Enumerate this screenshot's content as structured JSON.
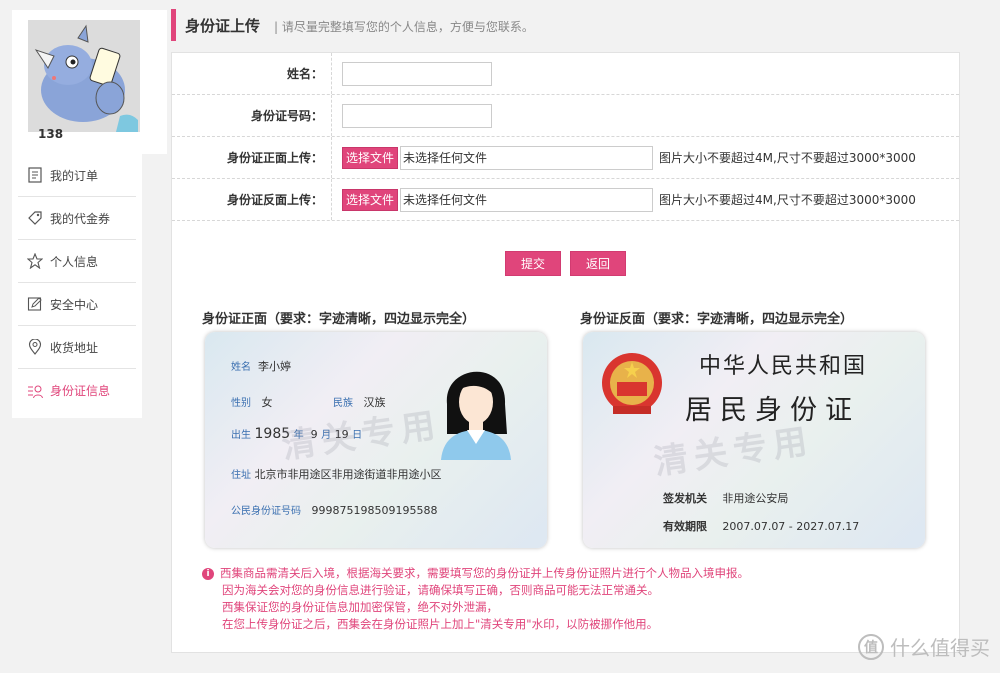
{
  "sidebar": {
    "username": "138",
    "items": [
      {
        "label": "我的订单",
        "icon": "order-list-icon"
      },
      {
        "label": "我的代金券",
        "icon": "coupon-tag-icon"
      },
      {
        "label": "个人信息",
        "icon": "star-icon"
      },
      {
        "label": "安全中心",
        "icon": "edit-shield-icon"
      },
      {
        "label": "收货地址",
        "icon": "location-pin-icon"
      },
      {
        "label": "身份证信息",
        "icon": "id-user-icon"
      }
    ],
    "active_index": 5
  },
  "header": {
    "title": "身份证上传",
    "subtitle": "| 请尽量完整填写您的个人信息，方便与您联系。"
  },
  "form": {
    "name_label": "姓名：",
    "name_value": "",
    "idno_label": "身份证号码：",
    "idno_value": "",
    "front_label": "身份证正面上传：",
    "back_label": "身份证反面上传：",
    "file_button": "选择文件",
    "file_none": "未选择任何文件",
    "size_hint": "图片大小不要超过4M,尺寸不要超过3000*3000",
    "submit": "提交",
    "back": "返回"
  },
  "samples": {
    "front_title": "身份证正面（要求：字迹清晰，四边显示完全）",
    "back_title": "身份证反面（要求：字迹清晰，四边显示完全）",
    "front": {
      "name_lbl": "姓名",
      "name": "李小婷",
      "sex_lbl": "性别",
      "sex": "女",
      "nation_lbl": "民族",
      "nation": "汉族",
      "birth_lbl": "出生",
      "year": "1985",
      "year_lbl": "年",
      "month": "9",
      "month_lbl": "月",
      "day": "19",
      "day_lbl": "日",
      "addr_lbl": "住址",
      "addr": "北京市非用途区非用途街道非用途小区",
      "id_lbl": "公民身份证号码",
      "id": "999875198509195588",
      "watermark": "清关专用"
    },
    "back": {
      "country": "中华人民共和国",
      "card": "居民身份证",
      "issuer_lbl": "签发机关",
      "issuer": "非用途公安局",
      "valid_lbl": "有效期限",
      "valid": "2007.07.07 - 2027.07.17",
      "watermark": "清关专用"
    }
  },
  "notice": {
    "icon": "i",
    "lines": [
      "西集商品需清关后入境，根据海关要求，需要填写您的身份证并上传身份证照片进行个人物品入境申报。",
      "因为海关会对您的身份信息进行验证，请确保填写正确，否则商品可能无法正常通关。",
      "西集保证您的身份证信息加加密保管，绝不对外泄漏，",
      "在您上传身份证之后，西集会在身份证照片上加上\"清关专用\"水印，以防被挪作他用。"
    ]
  },
  "watermark": {
    "symbol": "值",
    "text": "什么值得买"
  },
  "colors": {
    "accent": "#e0457b"
  }
}
